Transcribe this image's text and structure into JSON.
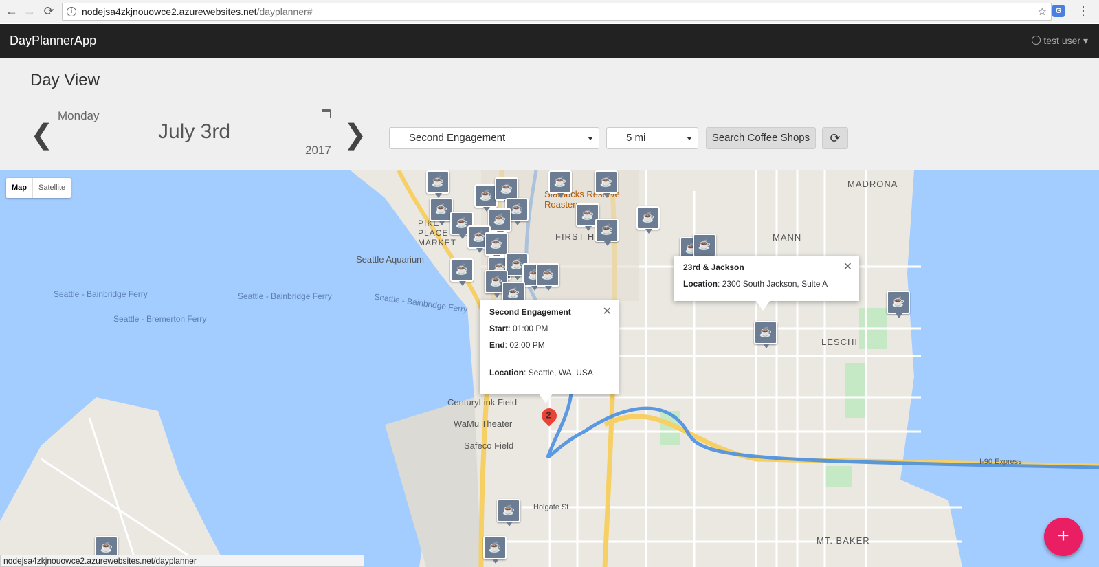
{
  "browser": {
    "url_host": "nodejsa4zkjnouowce2.azurewebsites.net",
    "url_path": "/dayplanner#",
    "back": "←",
    "forward": "→",
    "reload": "⟳",
    "info": "i",
    "bookmark": "☆",
    "extension": "G",
    "menu": "⋮"
  },
  "app": {
    "brand": "DayPlannerApp",
    "user": "test user"
  },
  "day": {
    "title": "Day View",
    "weekday": "Monday",
    "date": "July 3rd",
    "year": "2017",
    "prev": "❮",
    "next": "❯"
  },
  "controls": {
    "engagement": "Second Engagement",
    "radius": "5 mi",
    "search_label": "Search Coffee Shops",
    "refresh": "⟳"
  },
  "map": {
    "toggle_map": "Map",
    "toggle_satellite": "Satellite",
    "labels": {
      "madrona": "MADRONA",
      "mann": "MANN",
      "leschi": "LESCHI",
      "mt_baker": "MT. BAKER",
      "first_hill": "FIRST HILL",
      "pike_market": "PIKE PLACE MARKET",
      "starbucks": "Starbucks Reserve Roastery",
      "aquarium": "Seattle Aquarium",
      "ferry1": "Seattle - Bainbridge Ferry",
      "ferry2": "Seattle - Bainbridge Ferry",
      "ferry3": "Seattle - Bainbridge Ferry",
      "bremerton": "Seattle - Bremerton Ferry",
      "centurylink": "CenturyLink Field",
      "wamu": "WaMu Theater",
      "safeco": "Safeco Field",
      "i90": "I-90 Express",
      "holgate": "Holgate St"
    },
    "coffee_glyph": "☕",
    "pin_number": "2"
  },
  "infowindow_engagement": {
    "title": "Second Engagement",
    "start_label": "Start",
    "start": ": 01:00 PM",
    "end_label": "End",
    "end": ": 02:00 PM",
    "location_label": "Location",
    "location": ": Seattle, WA, USA",
    "close": "✕"
  },
  "infowindow_shop": {
    "title": "23rd & Jackson",
    "location_label": "Location",
    "location": ": 2300 South Jackson, Suite A",
    "close": "✕"
  },
  "fab": "+",
  "status_url": "nodejsa4zkjnouowce2.azurewebsites.net/dayplanner",
  "colors": {
    "navbar": "#222222",
    "fab": "#e91e63",
    "water": "#a3ccff",
    "marker": "#6b7c93",
    "route": "#4a90e2",
    "pin": "#ea4335"
  }
}
